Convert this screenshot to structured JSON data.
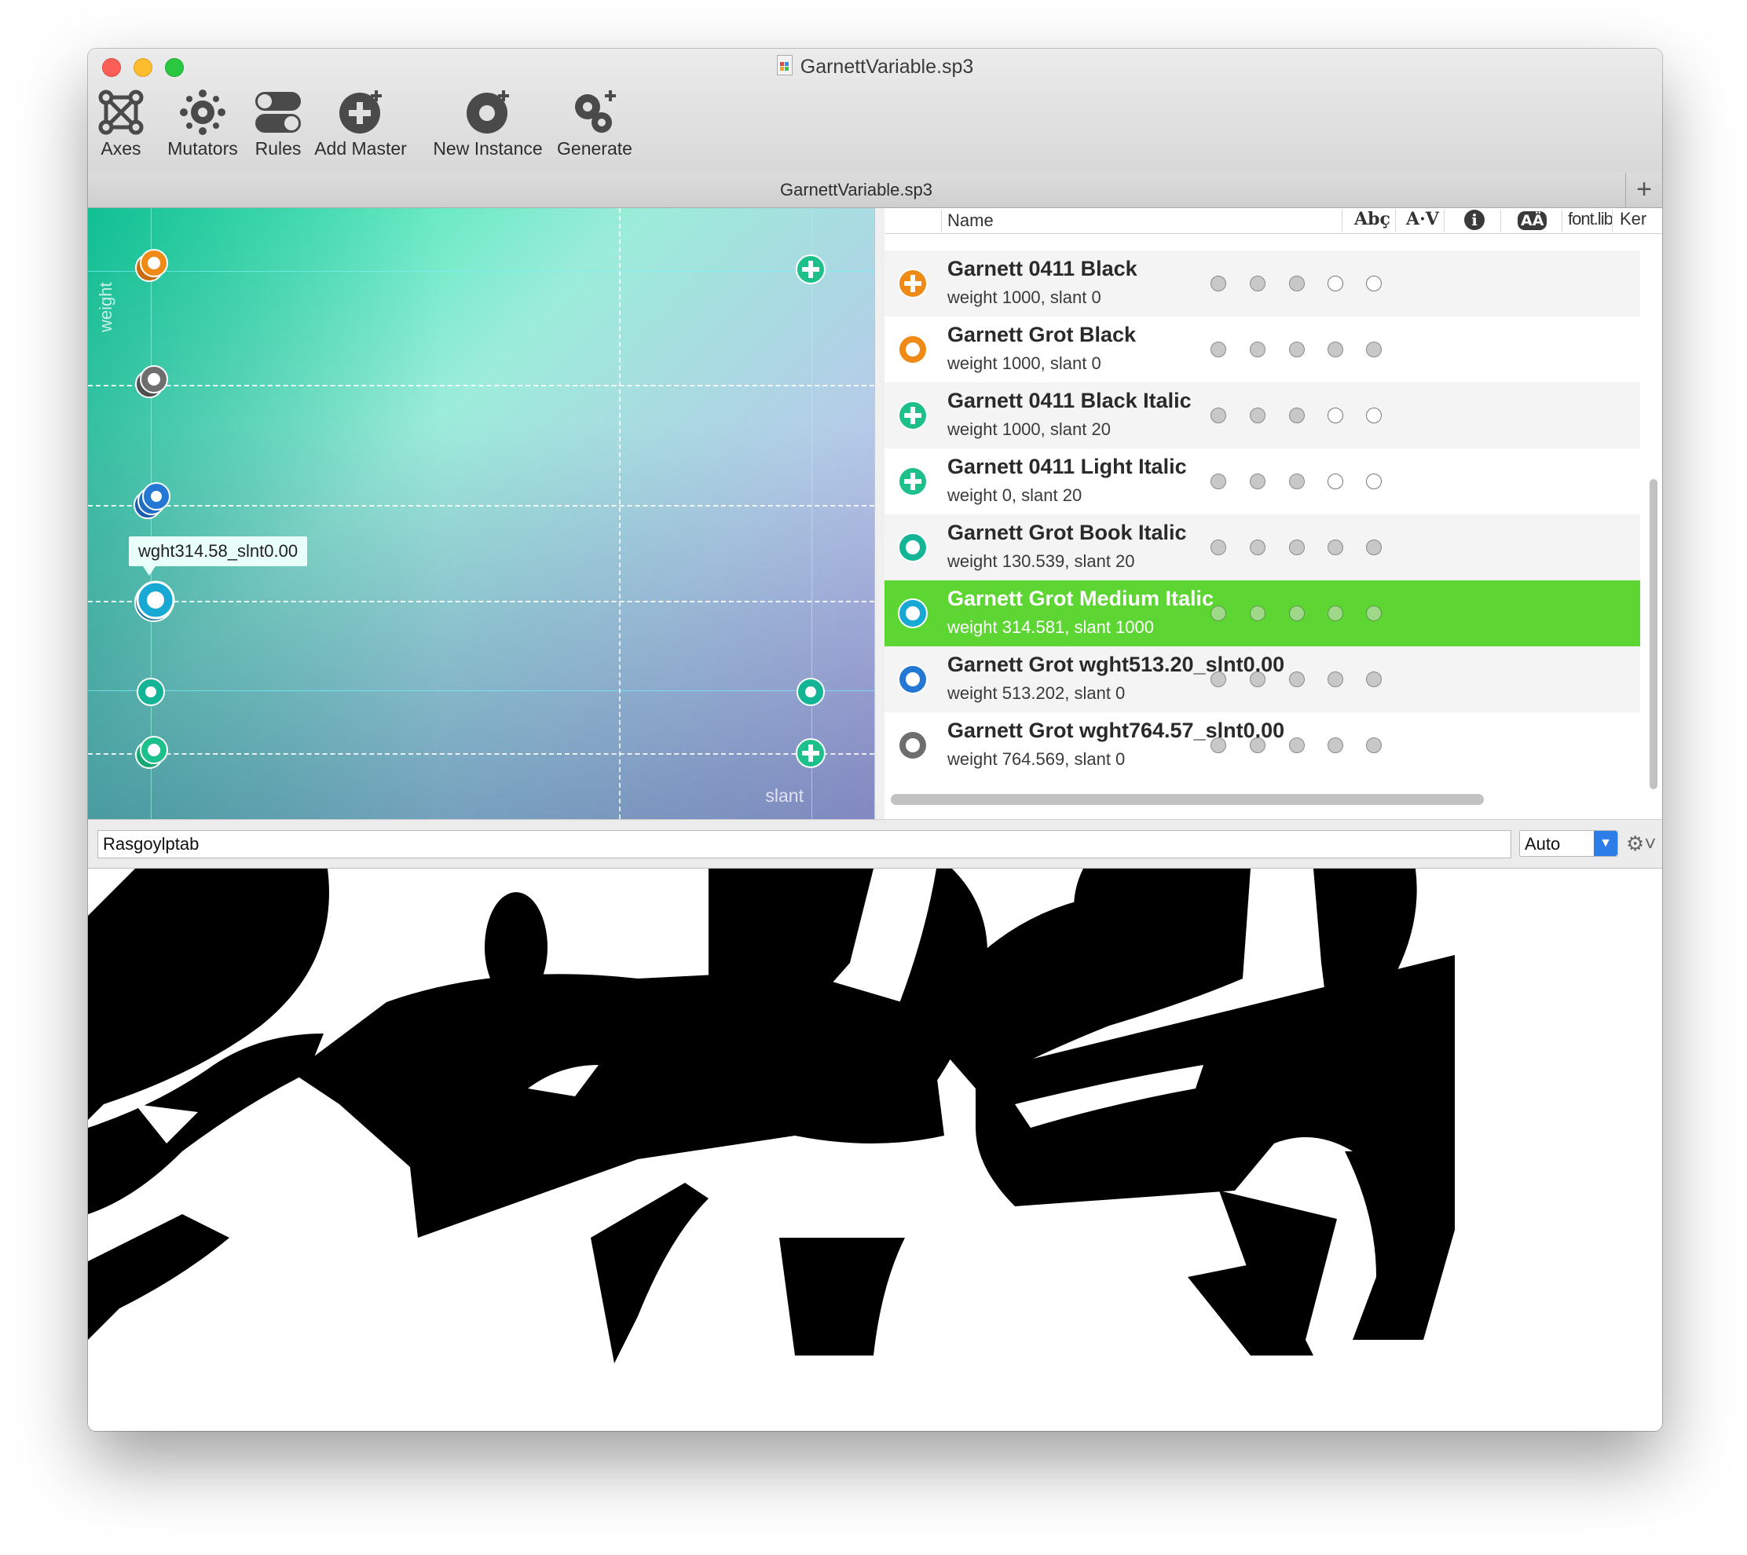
{
  "window": {
    "title": "GarnettVariable.sp3",
    "tab_title": "GarnettVariable.sp3",
    "tab_add": "+"
  },
  "toolbar": [
    {
      "label": "Axes",
      "icon": "axes-icon"
    },
    {
      "label": "Mutators",
      "icon": "mutators-icon"
    },
    {
      "label": "Rules",
      "icon": "rules-icon"
    },
    {
      "label": "Add Master",
      "icon": "add-master-icon"
    },
    {
      "label": "New Instance",
      "icon": "new-instance-icon"
    },
    {
      "label": "Generate",
      "icon": "generate-icon"
    }
  ],
  "design_space": {
    "axis_vertical": "weight",
    "axis_horizontal": "slant",
    "tooltip": "wght314.58_slnt0.00"
  },
  "columns": {
    "name": "Name",
    "preview": "Abç",
    "kerning_preview": "A·V",
    "info": "i",
    "case": "AÄ",
    "fontlib": "font.lib",
    "kern": "Ker"
  },
  "instances": [
    {
      "name": "",
      "detail": "weight 764.569, slant 0",
      "kind": "gray",
      "flags": [
        1,
        1,
        1,
        1,
        1
      ]
    },
    {
      "name": "Garnett 0411 Black",
      "detail": "weight 1000, slant 0",
      "kind": "master-orange",
      "flags": [
        1,
        1,
        1,
        0,
        0
      ]
    },
    {
      "name": "Garnett Grot Black",
      "detail": "weight 1000, slant 0",
      "kind": "orange",
      "flags": [
        1,
        1,
        1,
        1,
        1
      ]
    },
    {
      "name": "Garnett 0411 Black Italic",
      "detail": "weight 1000, slant 20",
      "kind": "master-green",
      "flags": [
        1,
        1,
        1,
        0,
        0
      ]
    },
    {
      "name": "Garnett 0411 Light Italic",
      "detail": "weight 0, slant 20",
      "kind": "master-green",
      "flags": [
        1,
        1,
        1,
        0,
        0
      ]
    },
    {
      "name": "Garnett Grot Book Italic",
      "detail": "weight 130.539, slant 20",
      "kind": "teal",
      "flags": [
        1,
        1,
        1,
        1,
        1
      ]
    },
    {
      "name": "Garnett Grot Medium Italic",
      "detail": "weight 314.581, slant 1000",
      "kind": "cyan",
      "flags": [
        1,
        1,
        1,
        1,
        1
      ],
      "selected": true
    },
    {
      "name": "Garnett Grot wght513.20_slnt0.00",
      "detail": "weight 513.202, slant 0",
      "kind": "blue",
      "flags": [
        1,
        1,
        1,
        1,
        1
      ]
    },
    {
      "name": "Garnett Grot wght764.57_slnt0.00",
      "detail": "weight 764.569, slant 0",
      "kind": "gray",
      "flags": [
        1,
        1,
        1,
        1,
        1
      ]
    }
  ],
  "preview": {
    "text": "Rasgoylptab",
    "size": "Auto",
    "gear_icon": "gear-icon"
  },
  "colors": {
    "selected_row": "#5dd532",
    "orange": "#ef8a17",
    "green": "#1dc08a",
    "teal": "#13b596",
    "cyan": "#17a8d4",
    "blue": "#2478d4",
    "gray": "#6e6e6e",
    "space_start": "#18e7a2",
    "space_end": "#c7a7ec"
  }
}
